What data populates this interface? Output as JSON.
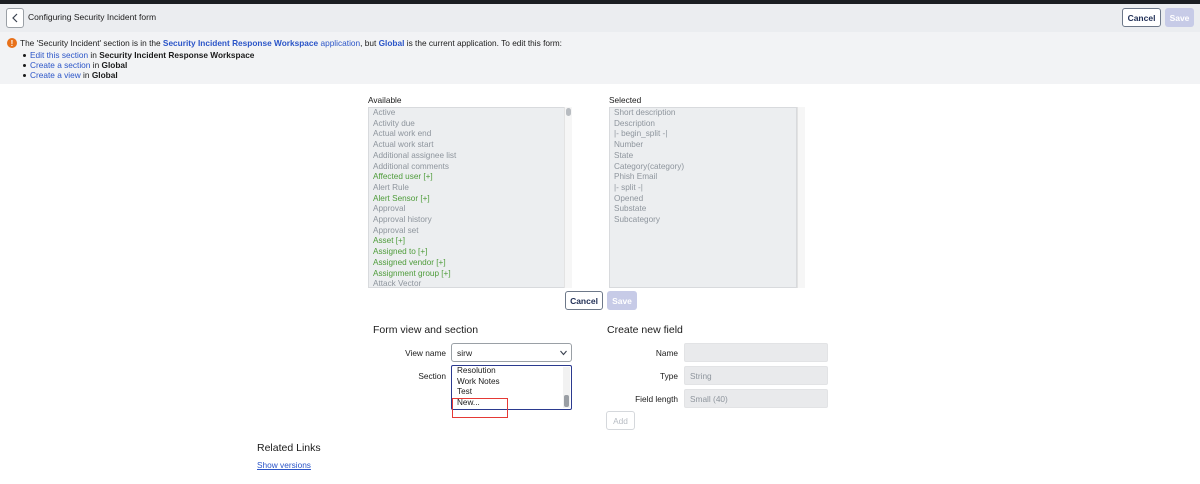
{
  "header": {
    "title": "Configuring Security Incident form",
    "cancel_label": "Cancel",
    "save_label": "Save"
  },
  "notice": {
    "intro": "The 'Security Incident' section is in the ",
    "app_link": "Security Incident Response Workspace",
    "app_word": "application",
    "but": ", but ",
    "global_link": "Global",
    "tail": " is the current application. To edit this form:",
    "items": [
      {
        "link": "Edit this section",
        "in": " in ",
        "target": "Security Incident Response Workspace"
      },
      {
        "link": "Create a section",
        "in": " in ",
        "target": "Global"
      },
      {
        "link": "Create a view",
        "in": " in ",
        "target": "Global"
      }
    ]
  },
  "available": {
    "label": "Available",
    "items": [
      {
        "text": "Active",
        "ref": false
      },
      {
        "text": "Activity due",
        "ref": false
      },
      {
        "text": "Actual work end",
        "ref": false
      },
      {
        "text": "Actual work start",
        "ref": false
      },
      {
        "text": "Additional assignee list",
        "ref": false
      },
      {
        "text": "Additional comments",
        "ref": false
      },
      {
        "text": "Affected user [+]",
        "ref": true
      },
      {
        "text": "Alert Rule",
        "ref": false
      },
      {
        "text": "Alert Sensor [+]",
        "ref": true
      },
      {
        "text": "Approval",
        "ref": false
      },
      {
        "text": "Approval history",
        "ref": false
      },
      {
        "text": "Approval set",
        "ref": false
      },
      {
        "text": "Asset [+]",
        "ref": true
      },
      {
        "text": "Assigned to [+]",
        "ref": true
      },
      {
        "text": "Assigned vendor [+]",
        "ref": true
      },
      {
        "text": "Assignment group [+]",
        "ref": true
      },
      {
        "text": "Attack Vector",
        "ref": false
      }
    ]
  },
  "selected": {
    "label": "Selected",
    "items": [
      "Short description",
      "Description",
      "|- begin_split -|",
      "Number",
      "State",
      "Category(category)",
      "Phish Email",
      "|- split -|",
      "Opened",
      "Substate",
      "Subcategory"
    ]
  },
  "slush_buttons": {
    "cancel_label": "Cancel",
    "save_label": "Save"
  },
  "form_view": {
    "heading": "Form view and section",
    "view_name_label": "View name",
    "view_name_value": "sirw",
    "section_label": "Section",
    "section_options": [
      "Resolution",
      "Work Notes",
      "Test",
      "New..."
    ]
  },
  "new_field": {
    "heading": "Create new field",
    "name_label": "Name",
    "name_value": "",
    "type_label": "Type",
    "type_value": "String",
    "length_label": "Field length",
    "length_value": "Small (40)",
    "add_label": "Add"
  },
  "related": {
    "title": "Related Links",
    "show_versions": "Show versions"
  }
}
